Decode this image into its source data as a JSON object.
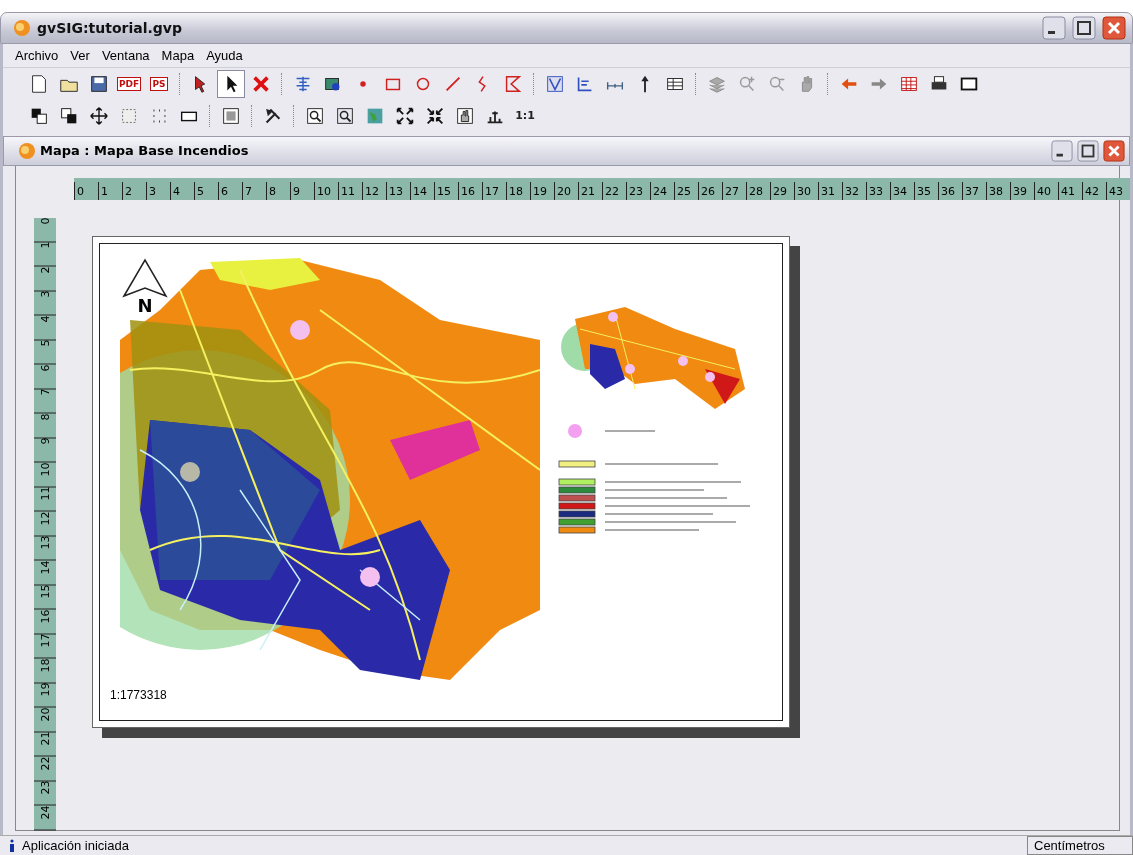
{
  "window": {
    "title": "gvSIG:tutorial.gvp"
  },
  "menu": [
    {
      "label": "Archivo"
    },
    {
      "label": "Ver"
    },
    {
      "label": "Ventana"
    },
    {
      "label": "Mapa"
    },
    {
      "label": "Ayuda"
    }
  ],
  "toolbar": {
    "pdf_text": "PDF",
    "ps_text": "PS",
    "pointer_selected": true,
    "zoom_real_text": "1:1"
  },
  "map_window": {
    "title": "Mapa : Mapa Base Incendios",
    "ruler_horizontal": [
      "0",
      "1",
      "2",
      "3",
      "4",
      "5",
      "6",
      "7",
      "8",
      "9",
      "10",
      "11",
      "12",
      "13",
      "14",
      "15",
      "16",
      "17",
      "18",
      "19",
      "20",
      "21",
      "22",
      "23",
      "24",
      "25",
      "26",
      "27",
      "28",
      "29",
      "30",
      "31",
      "32",
      "33",
      "34",
      "35",
      "36",
      "37",
      "38",
      "39",
      "40",
      "41",
      "42",
      "43"
    ],
    "ruler_vertical": [
      "0",
      "1",
      "2",
      "3",
      "4",
      "5",
      "6",
      "7",
      "8",
      "9",
      "10",
      "11",
      "12",
      "13",
      "14",
      "15",
      "16",
      "17",
      "18",
      "19",
      "20",
      "21",
      "22",
      "23",
      "24"
    ],
    "north_label": "N",
    "scale": "1:1773318",
    "legend": [
      {
        "color": "#f4a0f0"
      },
      {
        "color": "#f0f080"
      },
      {
        "color": "#b0f060"
      },
      {
        "color": "#2e8b3c"
      },
      {
        "color": "#c05050"
      },
      {
        "color": "#d01818"
      },
      {
        "color": "#1c2a80"
      },
      {
        "color": "#40a030"
      },
      {
        "color": "#f08a10"
      }
    ]
  },
  "status_bar": {
    "message": "Aplicación iniciada",
    "units": "Centímetros"
  }
}
